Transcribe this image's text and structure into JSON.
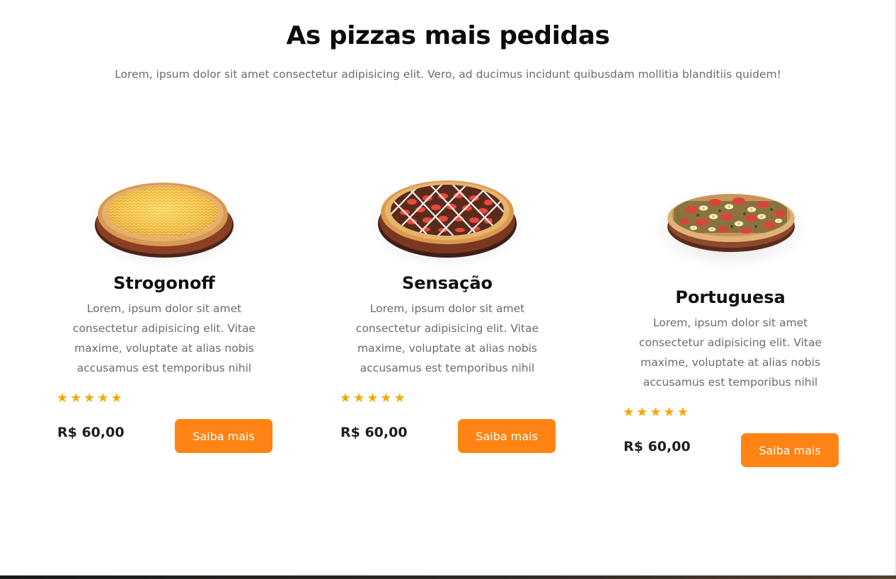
{
  "section": {
    "title": "As pizzas mais pedidas",
    "subtitle": "Lorem, ipsum dolor sit amet consectetur adipisicing elit. Vero, ad ducimus incidunt quibusdam mollitia blanditiis quidem!"
  },
  "pizzas": [
    {
      "name": "Strogonoff",
      "description": "Lorem, ipsum dolor sit amet consectetur adipisicing elit. Vitae maxime, voluptate at alias nobis accusamus est temporibus nihil",
      "rating": 5,
      "price": "R$ 60,00",
      "button_label": "Saiba mais",
      "image": "strogonoff-pizza"
    },
    {
      "name": "Sensação",
      "description": "Lorem, ipsum dolor sit amet consectetur adipisicing elit. Vitae maxime, voluptate at alias nobis accusamus est temporibus nihil",
      "rating": 5,
      "price": "R$ 60,00",
      "button_label": "Saiba mais",
      "image": "sensacao-pizza"
    },
    {
      "name": "Portuguesa",
      "description": "Lorem, ipsum dolor sit amet consectetur adipisicing elit. Vitae maxime, voluptate at alias nobis accusamus est temporibus nihil",
      "rating": 5,
      "price": "R$ 60,00",
      "button_label": "Saiba mais",
      "image": "portuguesa-pizza"
    }
  ],
  "colors": {
    "accent": "#ff8413",
    "star": "#f2a900",
    "heading": "#0c0c0c",
    "muted_text": "#6b6b6b"
  }
}
